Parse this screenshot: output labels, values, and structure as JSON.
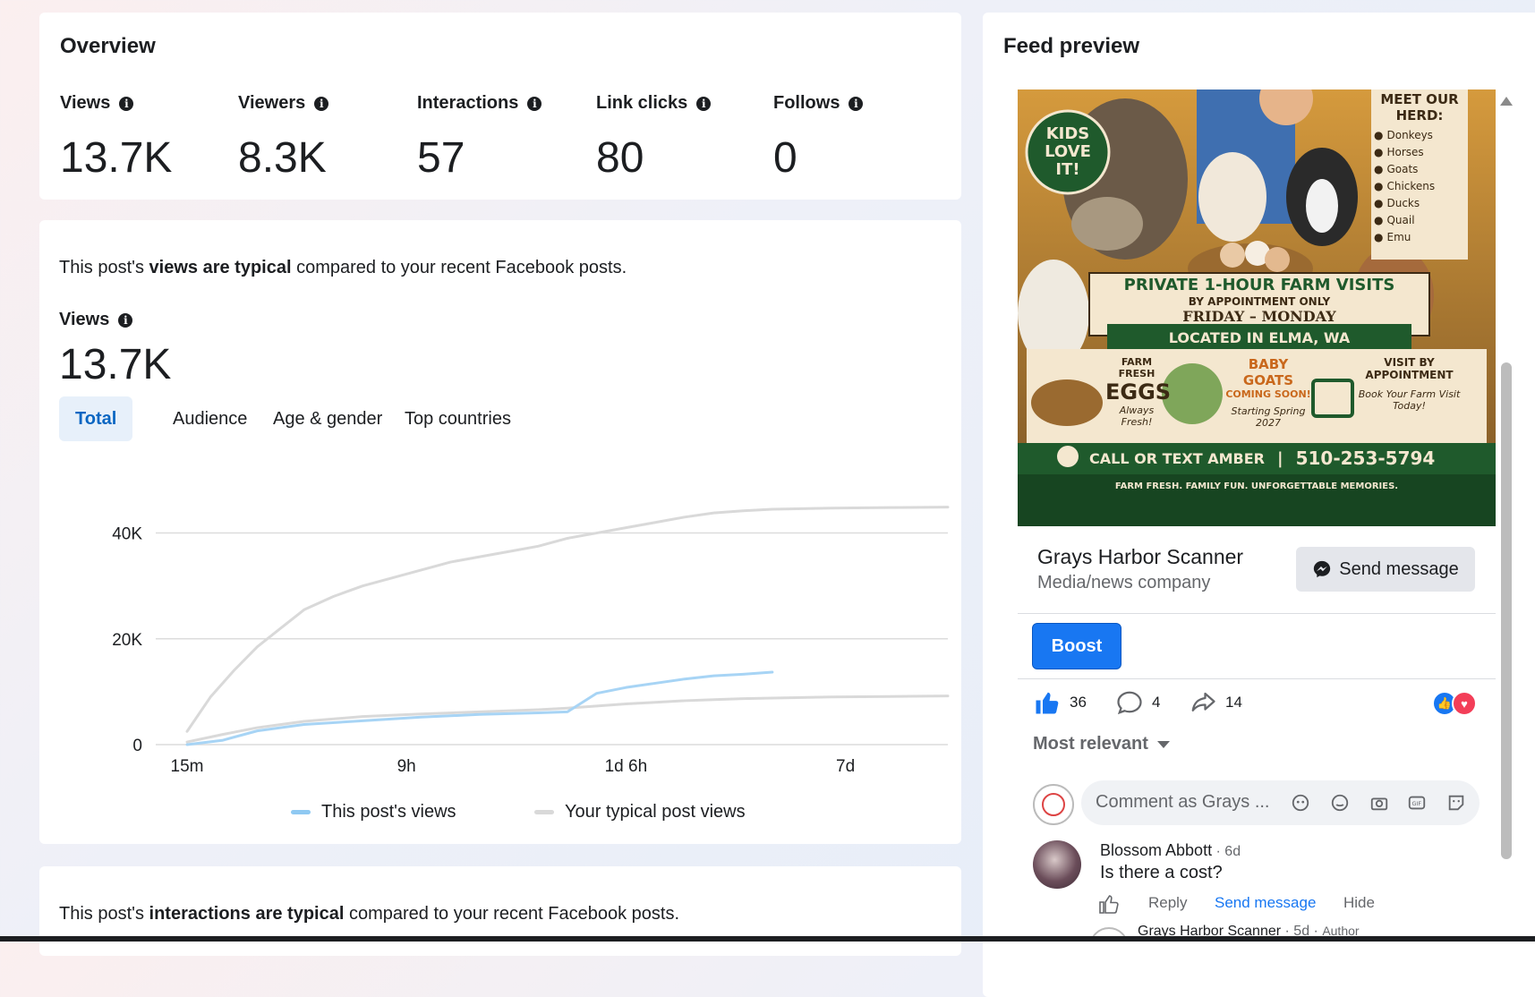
{
  "overview": {
    "title": "Overview",
    "metrics": [
      {
        "label": "Views",
        "value": "13.7K"
      },
      {
        "label": "Viewers",
        "value": "8.3K"
      },
      {
        "label": "Interactions",
        "value": "57"
      },
      {
        "label": "Link clicks",
        "value": "80"
      },
      {
        "label": "Follows",
        "value": "0"
      }
    ]
  },
  "views_card": {
    "sentence_pre": "This post's ",
    "sentence_bold": "views are typical",
    "sentence_post": " compared to your recent Facebook posts.",
    "label": "Views",
    "value": "13.7K",
    "tabs": [
      "Total",
      "Audience",
      "Age & gender",
      "Top countries"
    ],
    "active_tab": "Total",
    "legend": [
      "This post's views",
      "Your typical post views"
    ]
  },
  "chart_data": {
    "type": "line",
    "x_ticks": [
      "15m",
      "9h",
      "1d 6h",
      "7d"
    ],
    "y_ticks": [
      "0",
      "20K",
      "40K"
    ],
    "ylim": [
      0,
      45000
    ],
    "grid": true,
    "legend_position": "bottom",
    "series": [
      {
        "name": "This post's views",
        "color": "#a7d4f5",
        "x": [
          0,
          0.06,
          0.12,
          0.2,
          0.3,
          0.4,
          0.5,
          0.6,
          0.65,
          0.7,
          0.75,
          0.8,
          0.85,
          0.9,
          0.95,
          1.0
        ],
        "values": [
          0,
          800,
          2600,
          3800,
          4500,
          5200,
          5700,
          6000,
          6200,
          9700,
          10800,
          11600,
          12400,
          13000,
          13300,
          13700
        ]
      },
      {
        "name": "Your typical post views",
        "color": "#d9d9d9",
        "typical": true,
        "x": [
          0,
          0.06,
          0.12,
          0.2,
          0.3,
          0.4,
          0.5,
          0.6,
          0.65,
          0.7,
          0.75,
          0.8,
          0.85,
          0.9,
          0.95,
          1.0,
          1.1,
          1.2,
          1.3
        ],
        "values": [
          500,
          1900,
          3200,
          4400,
          5300,
          5800,
          6200,
          6600,
          6900,
          7300,
          7700,
          8000,
          8300,
          8500,
          8700,
          8800,
          9000,
          9100,
          9200
        ]
      },
      {
        "name": "",
        "color": "#d9d9d9",
        "typical_upper": true,
        "x": [
          0,
          0.04,
          0.08,
          0.12,
          0.16,
          0.2,
          0.25,
          0.3,
          0.35,
          0.4,
          0.45,
          0.5,
          0.55,
          0.6,
          0.65,
          0.7,
          0.75,
          0.8,
          0.85,
          0.9,
          0.95,
          1.0,
          1.1,
          1.2,
          1.3
        ],
        "values": [
          2500,
          9000,
          14000,
          18500,
          22000,
          25500,
          28000,
          30000,
          31500,
          33000,
          34500,
          35500,
          36500,
          37500,
          39000,
          40000,
          41000,
          42000,
          43000,
          43800,
          44200,
          44500,
          44700,
          44800,
          44900
        ]
      }
    ]
  },
  "interactions_card": {
    "sentence_pre": "This post's ",
    "sentence_bold": "interactions are typical",
    "sentence_post": " compared to your recent Facebook posts."
  },
  "feed": {
    "title": "Feed preview",
    "ad": {
      "badge_line1": "KIDS",
      "badge_line2": "LOVE IT!",
      "herd_title": "MEET OUR HERD:",
      "herd_items": [
        "Donkeys",
        "Horses",
        "Goats",
        "Chickens",
        "Ducks",
        "Quail",
        "Emu"
      ],
      "headline": "PRIVATE 1-HOUR FARM VISITS",
      "sub1": "BY APPOINTMENT ONLY",
      "sub2": "FRIDAY – MONDAY",
      "location": "LOCATED IN ELMA, WA",
      "col1_top": "FARM FRESH",
      "col1_big": "EGGS",
      "col1_note": "Always Fresh!",
      "col2_big": "BABY GOATS",
      "col2_sub": "COMING SOON!",
      "col2_note": "Starting Spring 2027",
      "col3_top": "VISIT BY APPOINTMENT",
      "col3_note": "Book Your Farm Visit Today!",
      "cta": "CALL OR TEXT AMBER",
      "phone": "510-253-5794",
      "tagline": "FARM FRESH. FAMILY FUN. UNFORGETTABLE MEMORIES."
    },
    "page_name": "Grays Harbor Scanner",
    "page_category": "Media/news company",
    "send_message": "Send message",
    "boost": "Boost",
    "likes": "36",
    "comments": "4",
    "shares": "14",
    "sort_label": "Most relevant",
    "comment_placeholder": "Comment as Grays ...",
    "comment": {
      "author": "Blossom Abbott",
      "time": " · 6d",
      "text": "Is there a cost?",
      "reply": "Reply",
      "send_message": "Send message",
      "hide": "Hide"
    },
    "next_comment": {
      "author": "Grays Harbor Scanner",
      "meta": "· 5d ·",
      "badge": "Author"
    }
  }
}
